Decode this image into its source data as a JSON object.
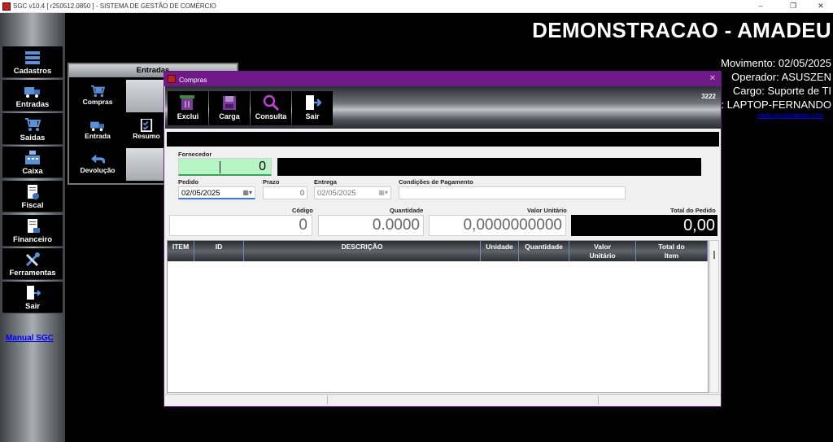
{
  "window": {
    "title": "SGC v10.4 [ r250512.0850 ] - SISTEMA DE GESTÃO DE COMÉRCIO",
    "minimize": "–",
    "maximize": "❐",
    "close": "✕"
  },
  "sidebar": {
    "items": [
      {
        "label": "Cadastros",
        "icon": "database-icon"
      },
      {
        "label": "Entradas",
        "icon": "truck-icon"
      },
      {
        "label": "Saidas",
        "icon": "cart-icon"
      },
      {
        "label": "Caixa",
        "icon": "cash-register-icon"
      },
      {
        "label": "Fiscal",
        "icon": "fiscal-document-icon"
      },
      {
        "label": "Financeiro",
        "icon": "finance-document-icon"
      },
      {
        "label": "Ferramentas",
        "icon": "tools-icon"
      },
      {
        "label": "Sair",
        "icon": "exit-door-icon"
      }
    ],
    "manual_link": "Manual SGC"
  },
  "header": {
    "title": "DEMONSTRACAO - AMADEU",
    "movimento": "Movimento: 02/05/2025",
    "operador": "Operador: ASUSZEN",
    "cargo": "Cargo: Suporte de TI",
    "computador": "r: LAPTOP-FERNANDO",
    "website": "www.sgcsistemas.com"
  },
  "submenu": {
    "title": "Entradas",
    "items": [
      {
        "label": "Compras",
        "icon": "cart-icon"
      },
      {
        "label": "Entrada",
        "icon": "truck-icon"
      },
      {
        "label": "Resumo",
        "icon": "checklist-icon"
      },
      {
        "label": "Devolução",
        "icon": "return-arrow-icon"
      }
    ]
  },
  "dialog": {
    "title": "Compras",
    "close": "✕",
    "doc_number": "3222",
    "toolbar": [
      {
        "label": "Exclui",
        "icon": "delete-icon"
      },
      {
        "label": "Carga",
        "icon": "load-icon"
      },
      {
        "label": "Consulta",
        "icon": "magnifier-icon"
      },
      {
        "label": "Sair",
        "icon": "exit-door-icon"
      }
    ],
    "fornecedor": {
      "label": "Fornecedor",
      "code": "0",
      "name": ""
    },
    "pedido": {
      "label": "Pedido",
      "value": "02/05/2025"
    },
    "prazo": {
      "label": "Prazo",
      "value": "0"
    },
    "entrega": {
      "label": "Entrega",
      "value": "02/05/2025"
    },
    "condicoes": {
      "label": "Condições de Pagamento",
      "value": ""
    },
    "codigo": {
      "label": "Código",
      "value": "0"
    },
    "quantidade": {
      "label": "Quantidade",
      "value": "0.0000"
    },
    "valor_unitario": {
      "label": "Valor Unitário",
      "value": "0,0000000000"
    },
    "total_pedido": {
      "label": "Total do Pedido",
      "value": "0,00"
    },
    "grid_columns": [
      "ITEM",
      "ID",
      "DESCRIÇÃO",
      "Unidade",
      "Quantidade",
      "Valor Unitário",
      "Total do Item"
    ]
  },
  "colors": {
    "dialog_title": "#701a88",
    "fornecedor_code_bg": "#b8f5c4",
    "link": "#0000ff"
  }
}
